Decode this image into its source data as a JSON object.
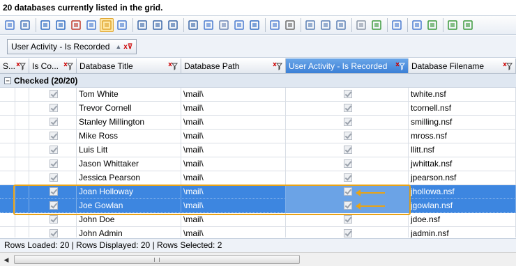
{
  "title": "20 databases currently listed in the grid.",
  "toolbar": {
    "icons": [
      "properties-icon",
      "open-icon",
      "add-icon",
      "remove-icon",
      "move-icon",
      "copy-icon",
      "group-panel-icon",
      "fit-icon",
      "columns-icon",
      "columns2-icon",
      "columns3-icon",
      "select-icon",
      "copy-rows-icon",
      "paste-icon",
      "export-icon",
      "import-icon",
      "refresh-icon",
      "settings-icon",
      "zoom-icon",
      "zoom-in-icon",
      "zoom-out-icon",
      "filter-icon",
      "add-filter-icon",
      "report-icon",
      "preview-icon",
      "back-icon",
      "forward-icon",
      "panel-icon"
    ]
  },
  "groupbar": {
    "chip_label": "User Activity - Is Recorded"
  },
  "grid": {
    "columns": [
      {
        "label": "S..."
      },
      {
        "label": "Is Co..."
      },
      {
        "label": "Database Title"
      },
      {
        "label": "Database Path"
      },
      {
        "label": "User Activity - Is Recorded"
      },
      {
        "label": "Database Filename"
      }
    ],
    "group_label": "Checked (20/20)",
    "rows": [
      {
        "title": "Tom White",
        "path": "\\mail\\",
        "filename": "twhite.nsf"
      },
      {
        "title": "Trevor Cornell",
        "path": "\\mail\\",
        "filename": "tcornell.nsf"
      },
      {
        "title": "Stanley Millington",
        "path": "\\mail\\",
        "filename": "smilling.nsf"
      },
      {
        "title": "Mike Ross",
        "path": "\\mail\\",
        "filename": "mross.nsf"
      },
      {
        "title": "Luis Litt",
        "path": "\\mail\\",
        "filename": "llitt.nsf"
      },
      {
        "title": "Jason Whittaker",
        "path": "\\mail\\",
        "filename": "jwhittak.nsf"
      },
      {
        "title": "Jessica Pearson",
        "path": "\\mail\\",
        "filename": "jpearson.nsf"
      },
      {
        "title": "Joan Holloway",
        "path": "\\mail\\",
        "filename": "jhollowa.nsf"
      },
      {
        "title": "Joe Gowlan",
        "path": "\\mail\\",
        "filename": "jgowlan.nsf"
      },
      {
        "title": "John Doe",
        "path": "\\mail\\",
        "filename": "jdoe.nsf"
      },
      {
        "title": "John Admin",
        "path": "\\mail\\",
        "filename": "jadmin.nsf"
      }
    ]
  },
  "status": {
    "text": "Rows Loaded: 20  |  Rows Displayed: 20  |  Rows Selected: 2"
  },
  "colors": {
    "selection": "#3d86e0",
    "highlight": "#e8a317",
    "header_selected": "#3b7fd6"
  }
}
